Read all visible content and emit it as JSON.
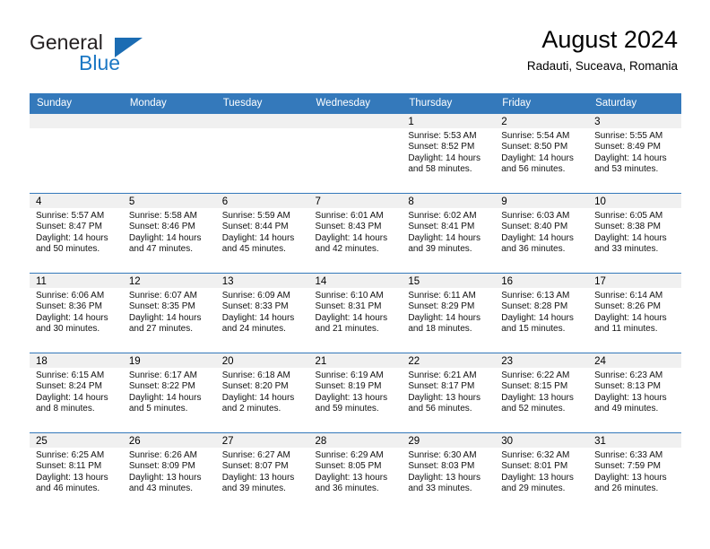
{
  "brand": {
    "line1": "General",
    "line2": "Blue",
    "flag_icon": "triangle-flag-icon",
    "color_primary": "#1b6cb3",
    "color_text": "#231f20"
  },
  "header": {
    "title": "August 2024",
    "subtitle": "Radauti, Suceava, Romania"
  },
  "theme": {
    "header_bg": "#3479bb",
    "header_text": "#ffffff",
    "daynum_bg": "#f0f0f0",
    "grid_line": "#3479bb",
    "cell_bg": "#ffffff"
  },
  "weekday_headers": [
    "Sunday",
    "Monday",
    "Tuesday",
    "Wednesday",
    "Thursday",
    "Friday",
    "Saturday"
  ],
  "weeks": [
    [
      {
        "day": "",
        "sunrise": "",
        "sunset": "",
        "daylight": "",
        "daylight2": ""
      },
      {
        "day": "",
        "sunrise": "",
        "sunset": "",
        "daylight": "",
        "daylight2": ""
      },
      {
        "day": "",
        "sunrise": "",
        "sunset": "",
        "daylight": "",
        "daylight2": ""
      },
      {
        "day": "",
        "sunrise": "",
        "sunset": "",
        "daylight": "",
        "daylight2": ""
      },
      {
        "day": "1",
        "sunrise": "Sunrise: 5:53 AM",
        "sunset": "Sunset: 8:52 PM",
        "daylight": "Daylight: 14 hours",
        "daylight2": "and 58 minutes."
      },
      {
        "day": "2",
        "sunrise": "Sunrise: 5:54 AM",
        "sunset": "Sunset: 8:50 PM",
        "daylight": "Daylight: 14 hours",
        "daylight2": "and 56 minutes."
      },
      {
        "day": "3",
        "sunrise": "Sunrise: 5:55 AM",
        "sunset": "Sunset: 8:49 PM",
        "daylight": "Daylight: 14 hours",
        "daylight2": "and 53 minutes."
      }
    ],
    [
      {
        "day": "4",
        "sunrise": "Sunrise: 5:57 AM",
        "sunset": "Sunset: 8:47 PM",
        "daylight": "Daylight: 14 hours",
        "daylight2": "and 50 minutes."
      },
      {
        "day": "5",
        "sunrise": "Sunrise: 5:58 AM",
        "sunset": "Sunset: 8:46 PM",
        "daylight": "Daylight: 14 hours",
        "daylight2": "and 47 minutes."
      },
      {
        "day": "6",
        "sunrise": "Sunrise: 5:59 AM",
        "sunset": "Sunset: 8:44 PM",
        "daylight": "Daylight: 14 hours",
        "daylight2": "and 45 minutes."
      },
      {
        "day": "7",
        "sunrise": "Sunrise: 6:01 AM",
        "sunset": "Sunset: 8:43 PM",
        "daylight": "Daylight: 14 hours",
        "daylight2": "and 42 minutes."
      },
      {
        "day": "8",
        "sunrise": "Sunrise: 6:02 AM",
        "sunset": "Sunset: 8:41 PM",
        "daylight": "Daylight: 14 hours",
        "daylight2": "and 39 minutes."
      },
      {
        "day": "9",
        "sunrise": "Sunrise: 6:03 AM",
        "sunset": "Sunset: 8:40 PM",
        "daylight": "Daylight: 14 hours",
        "daylight2": "and 36 minutes."
      },
      {
        "day": "10",
        "sunrise": "Sunrise: 6:05 AM",
        "sunset": "Sunset: 8:38 PM",
        "daylight": "Daylight: 14 hours",
        "daylight2": "and 33 minutes."
      }
    ],
    [
      {
        "day": "11",
        "sunrise": "Sunrise: 6:06 AM",
        "sunset": "Sunset: 8:36 PM",
        "daylight": "Daylight: 14 hours",
        "daylight2": "and 30 minutes."
      },
      {
        "day": "12",
        "sunrise": "Sunrise: 6:07 AM",
        "sunset": "Sunset: 8:35 PM",
        "daylight": "Daylight: 14 hours",
        "daylight2": "and 27 minutes."
      },
      {
        "day": "13",
        "sunrise": "Sunrise: 6:09 AM",
        "sunset": "Sunset: 8:33 PM",
        "daylight": "Daylight: 14 hours",
        "daylight2": "and 24 minutes."
      },
      {
        "day": "14",
        "sunrise": "Sunrise: 6:10 AM",
        "sunset": "Sunset: 8:31 PM",
        "daylight": "Daylight: 14 hours",
        "daylight2": "and 21 minutes."
      },
      {
        "day": "15",
        "sunrise": "Sunrise: 6:11 AM",
        "sunset": "Sunset: 8:29 PM",
        "daylight": "Daylight: 14 hours",
        "daylight2": "and 18 minutes."
      },
      {
        "day": "16",
        "sunrise": "Sunrise: 6:13 AM",
        "sunset": "Sunset: 8:28 PM",
        "daylight": "Daylight: 14 hours",
        "daylight2": "and 15 minutes."
      },
      {
        "day": "17",
        "sunrise": "Sunrise: 6:14 AM",
        "sunset": "Sunset: 8:26 PM",
        "daylight": "Daylight: 14 hours",
        "daylight2": "and 11 minutes."
      }
    ],
    [
      {
        "day": "18",
        "sunrise": "Sunrise: 6:15 AM",
        "sunset": "Sunset: 8:24 PM",
        "daylight": "Daylight: 14 hours",
        "daylight2": "and 8 minutes."
      },
      {
        "day": "19",
        "sunrise": "Sunrise: 6:17 AM",
        "sunset": "Sunset: 8:22 PM",
        "daylight": "Daylight: 14 hours",
        "daylight2": "and 5 minutes."
      },
      {
        "day": "20",
        "sunrise": "Sunrise: 6:18 AM",
        "sunset": "Sunset: 8:20 PM",
        "daylight": "Daylight: 14 hours",
        "daylight2": "and 2 minutes."
      },
      {
        "day": "21",
        "sunrise": "Sunrise: 6:19 AM",
        "sunset": "Sunset: 8:19 PM",
        "daylight": "Daylight: 13 hours",
        "daylight2": "and 59 minutes."
      },
      {
        "day": "22",
        "sunrise": "Sunrise: 6:21 AM",
        "sunset": "Sunset: 8:17 PM",
        "daylight": "Daylight: 13 hours",
        "daylight2": "and 56 minutes."
      },
      {
        "day": "23",
        "sunrise": "Sunrise: 6:22 AM",
        "sunset": "Sunset: 8:15 PM",
        "daylight": "Daylight: 13 hours",
        "daylight2": "and 52 minutes."
      },
      {
        "day": "24",
        "sunrise": "Sunrise: 6:23 AM",
        "sunset": "Sunset: 8:13 PM",
        "daylight": "Daylight: 13 hours",
        "daylight2": "and 49 minutes."
      }
    ],
    [
      {
        "day": "25",
        "sunrise": "Sunrise: 6:25 AM",
        "sunset": "Sunset: 8:11 PM",
        "daylight": "Daylight: 13 hours",
        "daylight2": "and 46 minutes."
      },
      {
        "day": "26",
        "sunrise": "Sunrise: 6:26 AM",
        "sunset": "Sunset: 8:09 PM",
        "daylight": "Daylight: 13 hours",
        "daylight2": "and 43 minutes."
      },
      {
        "day": "27",
        "sunrise": "Sunrise: 6:27 AM",
        "sunset": "Sunset: 8:07 PM",
        "daylight": "Daylight: 13 hours",
        "daylight2": "and 39 minutes."
      },
      {
        "day": "28",
        "sunrise": "Sunrise: 6:29 AM",
        "sunset": "Sunset: 8:05 PM",
        "daylight": "Daylight: 13 hours",
        "daylight2": "and 36 minutes."
      },
      {
        "day": "29",
        "sunrise": "Sunrise: 6:30 AM",
        "sunset": "Sunset: 8:03 PM",
        "daylight": "Daylight: 13 hours",
        "daylight2": "and 33 minutes."
      },
      {
        "day": "30",
        "sunrise": "Sunrise: 6:32 AM",
        "sunset": "Sunset: 8:01 PM",
        "daylight": "Daylight: 13 hours",
        "daylight2": "and 29 minutes."
      },
      {
        "day": "31",
        "sunrise": "Sunrise: 6:33 AM",
        "sunset": "Sunset: 7:59 PM",
        "daylight": "Daylight: 13 hours",
        "daylight2": "and 26 minutes."
      }
    ]
  ]
}
